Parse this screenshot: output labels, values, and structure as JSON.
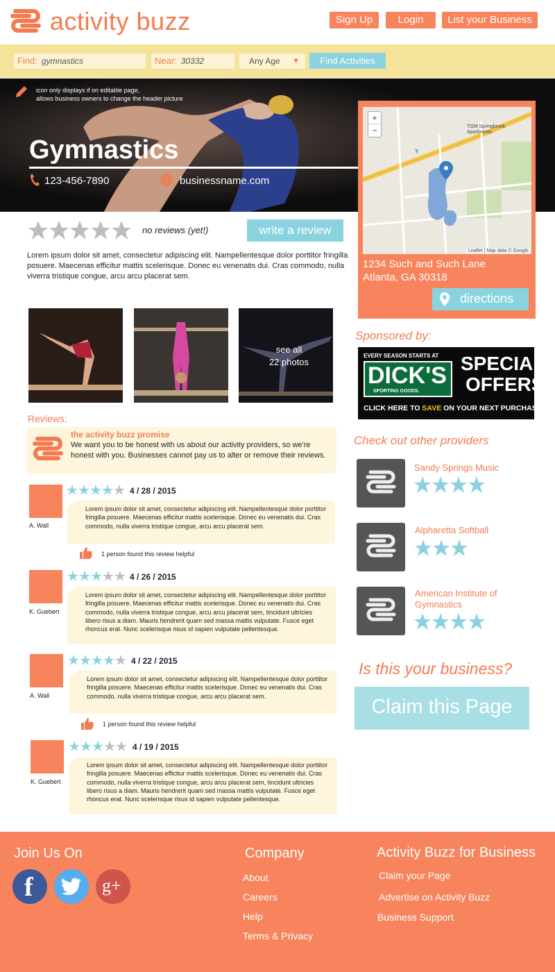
{
  "header": {
    "logo_text": "activity buzz",
    "signup": "Sign Up",
    "login": "Login",
    "list_business": "List your Business"
  },
  "search": {
    "find_label": "Find:",
    "find_value": "gymnastics",
    "near_label": "Near:",
    "near_value": "30332",
    "age_value": "Any Age",
    "submit": "Find Activities"
  },
  "hero": {
    "edit_note_line1": "icon only displays if on editable page,",
    "edit_note_line2": "allows business owners to change the header picture",
    "title": "Gymnastics",
    "phone": "123-456-7890",
    "website": "businessname.com"
  },
  "rating": {
    "text": "no reviews (yet!)",
    "write_review": "write a review"
  },
  "description": "Lorem ipsum dolor sit amet, consectetur adipiscing elit. Nampellentesque dolor porttitor fringilla posuere. Maecenas efficitur mattis scelerisque. Donec eu venenatis dui. Cras commodo, nulla viverra tristique congue, arcu arcu placerat sem.",
  "map": {
    "zoom_in": "+",
    "zoom_out": "−",
    "label_place": "TGM Springbrook Apartments",
    "attribution": "Leaflet | Map data © Google",
    "address_line1": "1234 Such and Such Lane",
    "address_line2": "Atlanta, GA 30318",
    "directions": "directions"
  },
  "photos": {
    "see_all_line1": "see all",
    "see_all_line2": "22 photos"
  },
  "sponsor": {
    "label": "Sponsored by:",
    "ad_top": "EVERY SEASON STARTS AT",
    "ad_brand": "DICK'S",
    "ad_brand_sub": "SPORTING GOODS.",
    "ad_offer_line1": "SPECIAL",
    "ad_offer_line2": "OFFERS",
    "ad_bottom_pre": "CLICK HERE TO ",
    "ad_bottom_save": "SAVE",
    "ad_bottom_post": " ON YOUR NEXT PURCHASE."
  },
  "reviews": {
    "heading": "Reviews:",
    "promise_title": "the activity buzz promise",
    "promise_text": "We want you to be honest with us about our activity providers, so we're honest with you. Businesses cannot pay us to alter or remove their reviews.",
    "items": [
      {
        "name": "A. Wall",
        "date": "4 / 28 / 2015",
        "stars": 4,
        "text": "Lorem ipsum dolor sit amet, consectetur adipiscing elit. Nampellentesque dolor porttitor fringilla posuere. Maecenas efficitur mattis scelerisque. Donec eu venenatis dui. Cras commodo, nulla viverra tristique congue, arcu arcu placerat sem.",
        "helpful": "1 person found this review helpful"
      },
      {
        "name": "K. Guebert",
        "date": "4 / 26 / 2015",
        "stars": 3,
        "text": "Lorem ipsum dolor sit amet, consectetur adipiscing elit. Nampellentesque dolor porttitor fringilla posuere. Maecenas efficitur mattis scelerisque. Donec eu venenatis dui. Cras commodo, nulla viverra tristique congue, arcu arcu placerat sem, tincidunt ultricies libero risus a diam. Mauris hendrerit quam sed massa mattis vulputate. Fusce eget rhoncus erat. Nunc scelerisque risus id sapien vulputate pellentesque.",
        "helpful": ""
      },
      {
        "name": "A. Wall",
        "date": "4 / 22 / 2015",
        "stars": 4,
        "text": "Lorem ipsum dolor sit amet, consectetur adipiscing elit. Nampellentesque dolor porttitor fringilla posuere. Maecenas efficitur mattis scelerisque. Donec eu venenatis dui. Cras commodo, nulla viverra tristique congue, arcu arcu placerat sem.",
        "helpful": "1 person found this review helpful"
      },
      {
        "name": "K. Guebert",
        "date": "4 / 19 / 2015",
        "stars": 3,
        "text": "Lorem ipsum dolor sit amet, consectetur adipiscing elit. Nampellentesque dolor porttitor fringilla posuere. Maecenas efficitur mattis scelerisque. Donec eu venenatis dui. Cras commodo, nulla viverra tristique congue, arcu arcu placerat sem, tincidunt ultricies libero risus a diam. Mauris hendrerit quam sed massa mattis vulputate. Fusce eget rhoncus erat. Nunc scelerisque risus id sapien vulputate pellentesque.",
        "helpful": ""
      }
    ]
  },
  "providers": {
    "heading": "Check out other providers",
    "items": [
      {
        "name": "Sandy Springs Music",
        "stars": 4
      },
      {
        "name": "Alpharetta Softball",
        "stars": 3
      },
      {
        "name": "American Institute of Gymnastics",
        "stars": 4
      }
    ]
  },
  "claim": {
    "question": "Is this your business?",
    "button": "Claim this Page"
  },
  "footer": {
    "join_heading": "Join Us On",
    "company_heading": "Company",
    "company_links": [
      "About",
      "Careers",
      "Help",
      "Terms & Privacy"
    ],
    "business_heading": "Activity Buzz for Business",
    "business_links": [
      "Claim your Page",
      "Advertise on Activity Buzz",
      "Business Support"
    ],
    "social_glyphs": [
      "f",
      "g+"
    ]
  },
  "colors": {
    "brand_orange": "#f7845c",
    "accent_teal": "#8ad3de",
    "search_yellow": "#f6e39a"
  }
}
